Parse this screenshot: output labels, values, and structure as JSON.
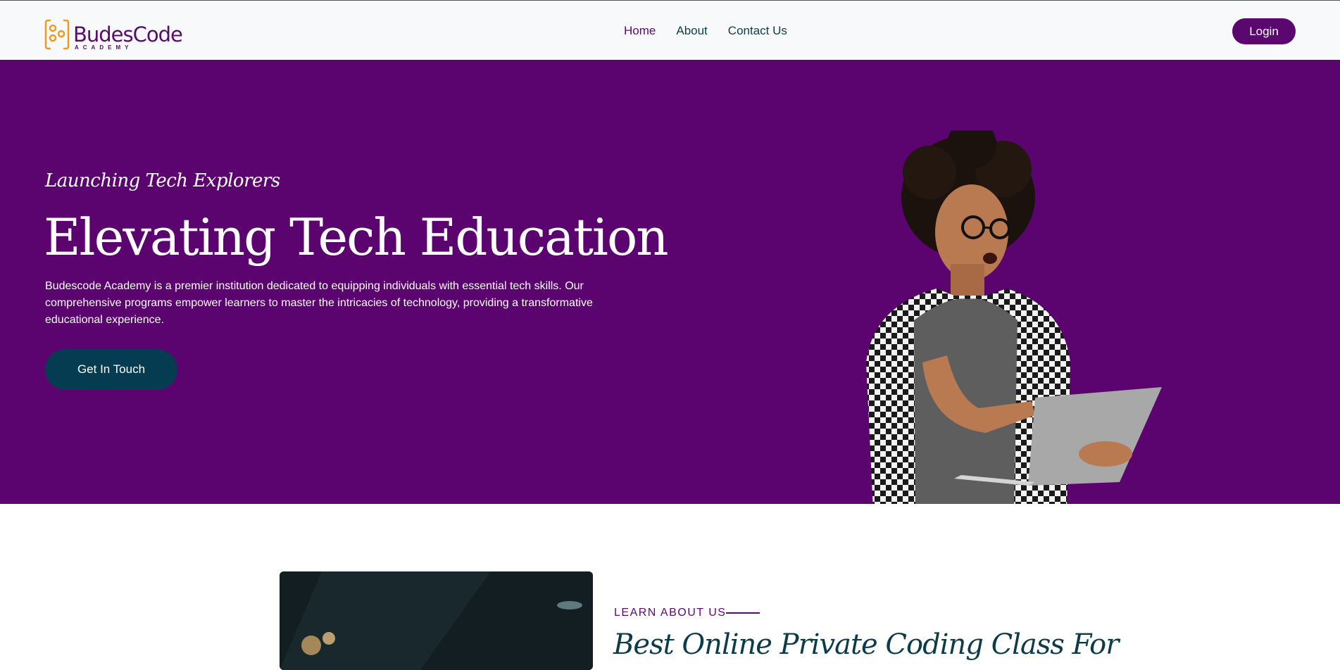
{
  "brand": {
    "name": "BudesCode",
    "tagline": "ACADEMY",
    "primary_color": "#5b0470",
    "accent_color": "#f29a1f",
    "dark_color": "#063c52"
  },
  "nav": {
    "items": [
      {
        "label": "Home"
      },
      {
        "label": "About"
      },
      {
        "label": "Contact Us"
      }
    ],
    "login_label": "Login"
  },
  "hero": {
    "eyebrow": "Launching Tech Explorers",
    "title": "Elevating Tech Education",
    "description": "Budescode Academy is a premier institution dedicated to equipping individuals with essential tech skills. Our comprehensive programs empower learners to master the intricacies of technology, providing a transformative educational experience.",
    "cta_label": "Get In Touch"
  },
  "about": {
    "eyebrow": "LEARN ABOUT US",
    "title": "Best Online Private Coding Class For"
  }
}
